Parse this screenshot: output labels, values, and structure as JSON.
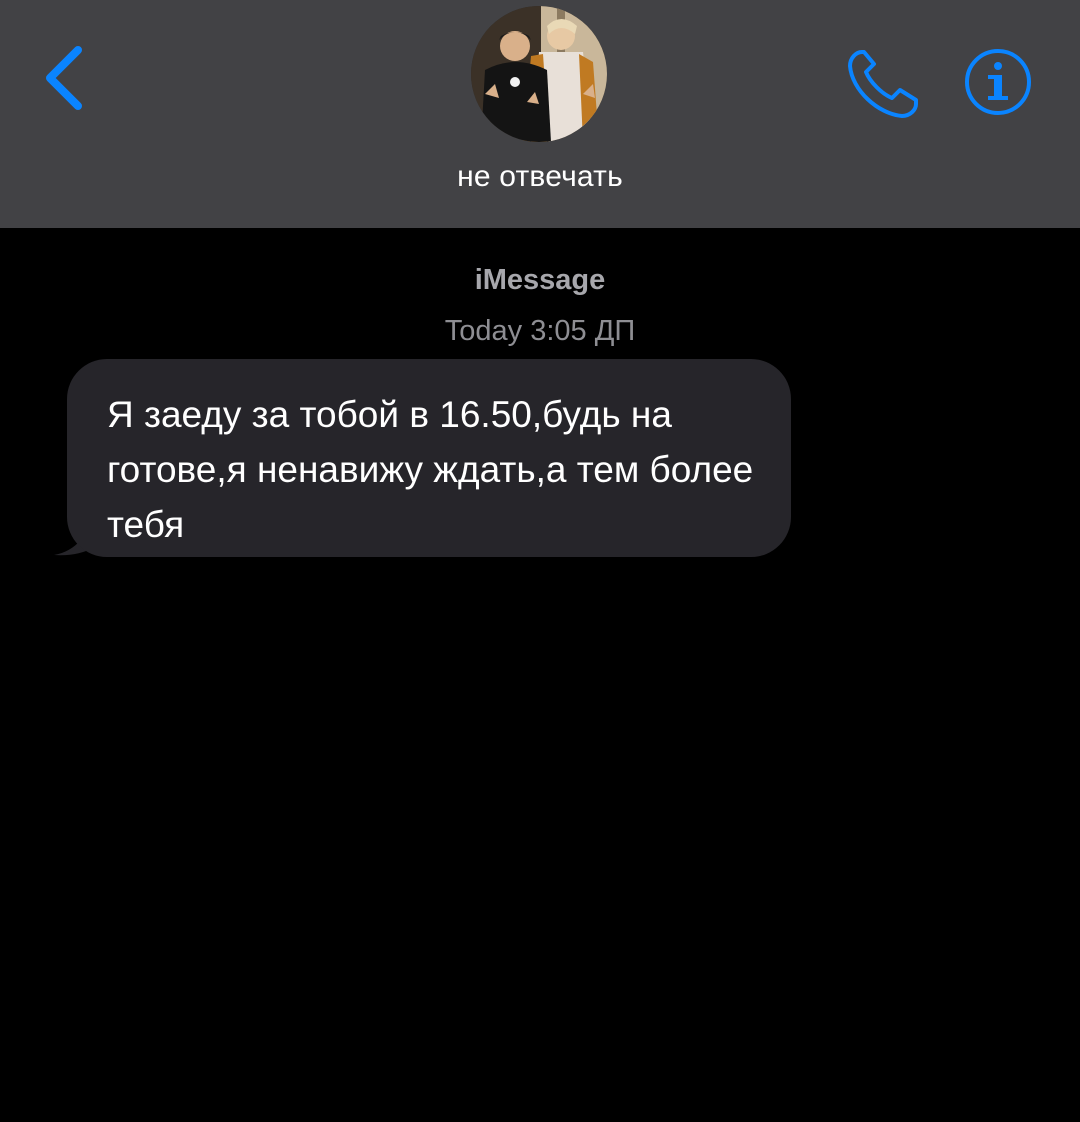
{
  "header": {
    "contact_name": "не отвечать",
    "back_icon": "chevron-left-icon",
    "call_icon": "phone-icon",
    "info_icon": "info-icon",
    "accent_color": "#0a84ff",
    "background_color": "#424245"
  },
  "thread": {
    "service_label": "iMessage",
    "timestamp": "Today 3:05 ДП",
    "messages": [
      {
        "direction": "incoming",
        "text": "Я заеду за тобой в 16.50,будь на готове,я ненавижу ждать,а тем более тебя"
      }
    ],
    "bubble_color": "#26252a",
    "background_color": "#000000"
  }
}
